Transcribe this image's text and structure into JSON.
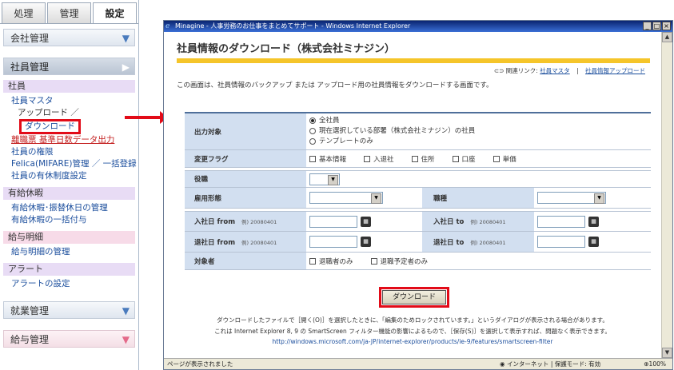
{
  "sidebar": {
    "tabs": [
      "処理",
      "管理",
      "設定"
    ],
    "active_tab": 2,
    "sections": {
      "company": "会社管理",
      "employee": "社員管理",
      "work": "就業管理",
      "payroll": "給与管理"
    },
    "categories": {
      "employee": "社員",
      "leave": "有給休暇",
      "payslip": "給与明細",
      "alert": "アラート"
    },
    "items": {
      "master": "社員マスタ",
      "upload": "アップロード",
      "slash": "／",
      "download": "ダウンロード",
      "retire": "離職票 基準日数データ出力",
      "permission": "社員の権限",
      "felica": "Felica(MIFARE)管理 ／ 一括登録",
      "leave_system": "社員の有休制度設定",
      "leave_manage": "有給休暇･振替休日の管理",
      "leave_bulk": "有給休暇の一括付与",
      "payslip_manage": "給与明細の管理",
      "alert_setting": "アラートの設定"
    }
  },
  "window": {
    "title": "Minagine - 人事労務のお仕事をまとめてサポート - Windows Internet Explorer",
    "buttons": [
      "_",
      "□",
      "×"
    ],
    "status_left": "ページが表示されました",
    "status_zone": "インターネット | 保護モード: 有効",
    "zoom": "100%"
  },
  "page": {
    "title": "社員情報のダウンロード（株式会社ミナジン）",
    "related_label": "関連リンク:",
    "related_links": [
      "社員マスタ",
      "社員情報アップロード"
    ],
    "related_sep": "|",
    "intro": "この画面は、社員情報のバックアップ または アップロード用の社員情報をダウンロードする画面です。"
  },
  "form": {
    "output": {
      "label": "出力対象",
      "options": [
        "全社員",
        "現在選択している部署（株式会社ミナジン）の社員",
        "テンプレートのみ"
      ],
      "selected": 0
    },
    "flags": {
      "label": "変更フラグ",
      "options": [
        "基本情報",
        "入退社",
        "住所",
        "口座",
        "単価"
      ]
    },
    "position": {
      "label": "役職"
    },
    "employment": {
      "label": "雇用形態"
    },
    "job_type": {
      "label": "職種"
    },
    "join_from": {
      "label": "入社日 from",
      "example": "例) 20080401"
    },
    "join_to": {
      "label": "入社日 to",
      "example": "例) 20080401"
    },
    "leave_from": {
      "label": "退社日 from",
      "example": "例) 20080401"
    },
    "leave_to": {
      "label": "退社日 to",
      "example": "例) 20080401"
    },
    "target": {
      "label": "対象者",
      "options": [
        "退職者のみ",
        "退職予定者のみ"
      ]
    },
    "download_button": "ダウンロード"
  },
  "notes": {
    "line1": "ダウンロードしたファイルで［開く(O)］を選択したときに、「編集のためロックされています。」というダイアログが表示される場合があります。",
    "line2": "これは Internet Explorer 8, 9 の SmartScreen フィルター機能の影響によるもので、［保存(S)］を選択して表示すれば、問題なく表示できます。",
    "link": "http://windows.microsoft.com/ja-JP/internet-explorer/products/ie-9/features/smartscreen-filter"
  }
}
